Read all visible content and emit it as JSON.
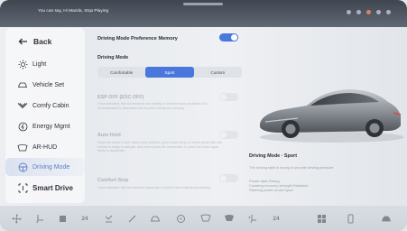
{
  "status_bar": {
    "voice_hint": "You can say, Hi Mazda, Stop Playing"
  },
  "sidebar": {
    "items": [
      {
        "label": "Back",
        "icon": "back-arrow-icon"
      },
      {
        "label": "Light",
        "icon": "light-icon"
      },
      {
        "label": "Vehicle Set",
        "icon": "vehicle-icon"
      },
      {
        "label": "Comfy Cabin",
        "icon": "cabin-icon"
      },
      {
        "label": "Energy Mgmt",
        "icon": "energy-icon"
      },
      {
        "label": "AR-HUD",
        "icon": "hud-icon"
      },
      {
        "label": "Driving Mode",
        "icon": "driving-mode-icon"
      },
      {
        "label": "Smart Drive",
        "icon": "smart-drive-icon"
      }
    ],
    "active_index": 6,
    "active_color": "#5a7fc4"
  },
  "panel": {
    "preference_memory_label": "Driving Mode Preference Memory",
    "preference_memory_on": true,
    "driving_mode_label": "Driving Mode",
    "modes": [
      "Comfortable",
      "Sport",
      "Custom"
    ],
    "selected_mode": "Sport",
    "esp": {
      "title": "ESP OFF  (ESC OFF)",
      "desc": "Once activated, this will enhance car stability in extreme road conditions; it is recommended to deactivate this function during car recovery",
      "on": false
    },
    "auto_hold": {
      "title": "Auto Hold",
      "desc": "Close the driver's door, fasten your seatbelt, press down firmly on brake pedal after the vehicle is ready to activate, and either press the accelerator or press the brake again firmly to deactivate",
      "on": false
    },
    "comfort_stop": {
      "title": "Comfort Stop",
      "desc": "Once activated, this will enhance passenger comfort when braking and parking",
      "on": false
    }
  },
  "mode_info": {
    "title": "Driving Mode · Sport",
    "lines": [
      "The driving style is strong to provide driving pleasure",
      "Power style:Strong",
      "Coasting recovery strength:Standard",
      "Steering power mode:Sport"
    ]
  },
  "dock": {
    "items": [
      {
        "icon": "fan-icon"
      },
      {
        "icon": "seat-icon"
      },
      {
        "icon": "defrost-icon"
      },
      {
        "text": "24",
        "icon": "temp-left-label"
      },
      {
        "icon": "steering-heat-icon"
      },
      {
        "icon": "wiper-icon"
      },
      {
        "icon": "car-icon"
      },
      {
        "icon": "ac-fan-icon"
      },
      {
        "icon": "rear-defrost-icon"
      },
      {
        "icon": "front-defrost-icon"
      },
      {
        "icon": "seat-heat-icon"
      },
      {
        "text": "24",
        "icon": "temp-right-label"
      },
      {
        "icon": "grid-icon"
      },
      {
        "icon": "phone-icon"
      },
      {
        "icon": "settings-car-icon"
      }
    ]
  },
  "colors": {
    "accent": "#4a77db",
    "statusbar": "#4b525c"
  }
}
